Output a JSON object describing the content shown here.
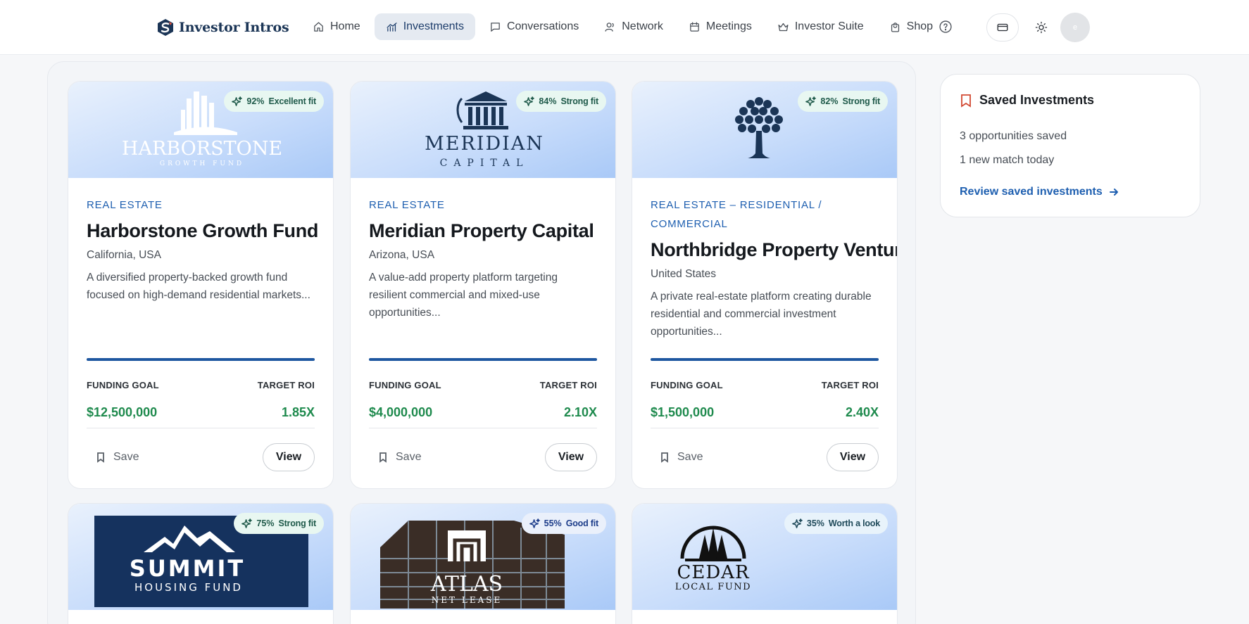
{
  "brand": {
    "name": "Investor Intros",
    "colors": {
      "navy": "#1b3556",
      "blue": "#1e5fb0",
      "green": "#1e8a4d",
      "accent_red": "#d24a33"
    }
  },
  "nav": {
    "items": [
      {
        "label": "Home",
        "icon": "home-icon",
        "active": false
      },
      {
        "label": "Investments",
        "icon": "chart-icon",
        "active": true
      },
      {
        "label": "Conversations",
        "icon": "message-icon",
        "active": false
      },
      {
        "label": "Network",
        "icon": "user-icon",
        "active": false
      },
      {
        "label": "Meetings",
        "icon": "calendar-icon",
        "active": false
      },
      {
        "label": "Investor Suite",
        "icon": "crown-icon",
        "active": false
      },
      {
        "label": "Shop",
        "icon": "shopping-bag-icon",
        "active": false
      }
    ],
    "help_icon": "help-circle-icon",
    "card_icon": "credit-card-icon",
    "theme_icon": "sun-icon",
    "avatar_text": "e"
  },
  "cards": [
    {
      "logo": {
        "name": "HARBORSTONE",
        "sub": "GROWTH FUND"
      },
      "fit_percent": "92%",
      "fit_label": "Excellent fit",
      "category": "REAL ESTATE",
      "title": "Harborstone Growth Fund",
      "location": "California, USA",
      "description": "A diversified property-backed growth fund focused on high-demand residential markets...",
      "funding_goal_label": "FUNDING GOAL",
      "funding_goal": "$12,500,000",
      "target_roi_label": "TARGET ROI",
      "target_roi": "1.85X",
      "save_label": "Save",
      "view_label": "View"
    },
    {
      "logo": {
        "name": "MERIDIAN",
        "sub": "CAPITAL"
      },
      "fit_percent": "84%",
      "fit_label": "Strong fit",
      "category": "REAL ESTATE",
      "title": "Meridian Property Capital",
      "location": "Arizona, USA",
      "description": "A value-add property platform targeting resilient commercial and mixed-use opportunities...",
      "funding_goal_label": "FUNDING GOAL",
      "funding_goal": "$4,000,000",
      "target_roi_label": "TARGET ROI",
      "target_roi": "2.10X",
      "save_label": "Save",
      "view_label": "View"
    },
    {
      "logo": {
        "name": "",
        "sub": ""
      },
      "fit_percent": "82%",
      "fit_label": "Strong fit",
      "category": "REAL ESTATE – RESIDENTIAL / COMMERCIAL",
      "title": "Northbridge Property Ventures",
      "location": "United States",
      "description": "A private real-estate platform creating durable residential and commercial investment opportunities...",
      "funding_goal_label": "FUNDING GOAL",
      "funding_goal": "$1,500,000",
      "target_roi_label": "TARGET ROI",
      "target_roi": "2.40X",
      "save_label": "Save",
      "view_label": "View"
    },
    {
      "logo": {
        "name": "SUMMIT",
        "sub": "HOUSING FUND"
      },
      "fit_percent": "75%",
      "fit_label": "Strong fit"
    },
    {
      "logo": {
        "name": "ATLAS",
        "sub": "NET LEASE"
      },
      "fit_percent": "55%",
      "fit_label": "Good fit"
    },
    {
      "logo": {
        "name": "CEDAR",
        "sub": "LOCAL FUND"
      },
      "fit_percent": "35%",
      "fit_label": "Worth a look"
    }
  ],
  "saved": {
    "title": "Saved Investments",
    "count_text": "3 opportunities saved",
    "match_text": "1 new match today",
    "link_text": "Review saved investments"
  }
}
